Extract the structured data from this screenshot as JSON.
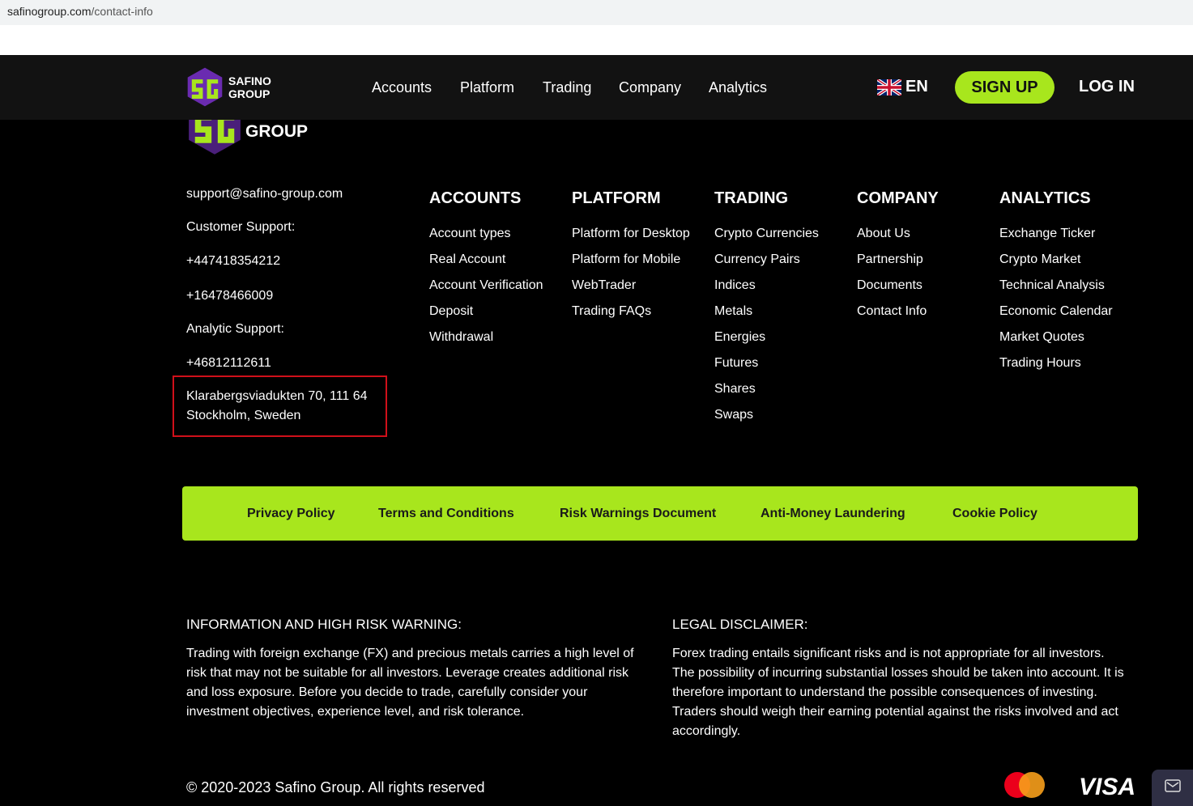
{
  "browser": {
    "url_host": "safinogroup.com",
    "url_path": "/contact-info"
  },
  "header": {
    "logo_line1": "SAFINO",
    "logo_line2": "GROUP",
    "nav": [
      "Accounts",
      "Platform",
      "Trading",
      "Company",
      "Analytics"
    ],
    "lang": "EN",
    "signup": "SIGN UP",
    "login": "LOG IN"
  },
  "footer_logo": {
    "text": "GROUP"
  },
  "contact": {
    "email": "support@safino-group.com",
    "customer_label": "Customer Support:",
    "phone1": "+447418354212",
    "phone2": "+16478466009",
    "analytic_label": "Analytic Support:",
    "phone3": "+46812112611",
    "address1": "Klarabergsviadukten 70, 111 64",
    "address2": "Stockholm, Sweden"
  },
  "columns": [
    {
      "title": "ACCOUNTS",
      "items": [
        "Account types",
        "Real Account",
        "Account Verification",
        "Deposit",
        "Withdrawal"
      ]
    },
    {
      "title": "PLATFORM",
      "items": [
        "Platform for Desktop",
        "Platform for Mobile",
        "WebTrader",
        "Trading FAQs"
      ]
    },
    {
      "title": "TRADING",
      "items": [
        "Crypto Currencies",
        "Currency Pairs",
        "Indices",
        "Metals",
        "Energies",
        "Futures",
        "Shares",
        "Swaps"
      ]
    },
    {
      "title": "COMPANY",
      "items": [
        "About Us",
        "Partnership",
        "Documents",
        "Contact Info"
      ]
    },
    {
      "title": "ANALYTICS",
      "items": [
        "Exchange Ticker",
        "Crypto Market",
        "Technical Analysis",
        "Economic Calendar",
        "Market Quotes",
        "Trading Hours"
      ]
    }
  ],
  "legal_links": [
    "Privacy Policy",
    "Terms and Conditions",
    "Risk Warnings Document",
    "Anti-Money Laundering",
    "Cookie Policy"
  ],
  "warning": {
    "title": "INFORMATION AND HIGH RISK WARNING:",
    "text": "Trading with foreign exchange (FX) and precious metals carries a high level of risk that may not be suitable for all investors. Leverage creates additional risk and loss exposure. Before you decide to trade, carefully consider your investment objectives, experience level, and risk tolerance."
  },
  "disclaimer": {
    "title": "LEGAL DISCLAIMER:",
    "text": "Forex trading entails significant risks and is not appropriate for all investors. The possibility of incurring substantial losses should be taken into account. It is therefore important to understand the possible consequences of investing. Traders should weigh their earning potential against the risks involved and act accordingly."
  },
  "copyright": "© 2020-2023 Safino Group. All rights reserved",
  "payments": {
    "visa": "VISA"
  },
  "colors": {
    "accent": "#a8e61d",
    "header_bg": "#121212",
    "logo_purple": "#6a2bb0"
  }
}
